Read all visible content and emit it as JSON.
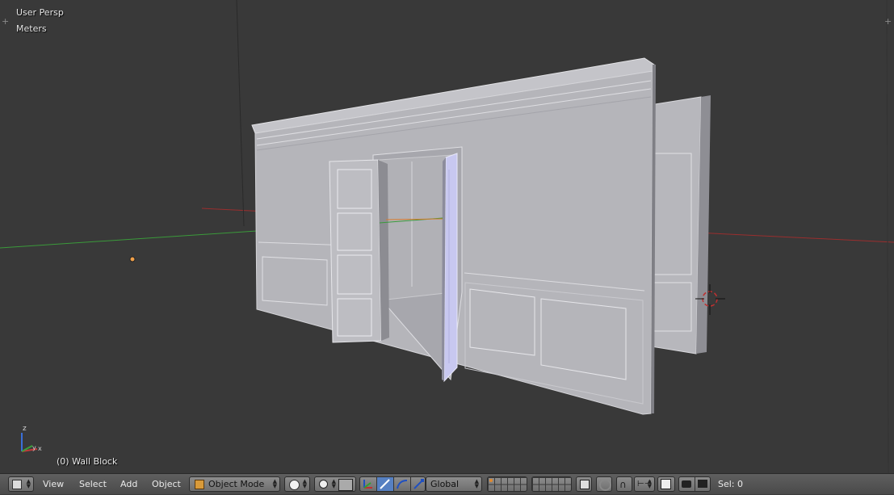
{
  "viewport": {
    "view_name": "User Persp",
    "units": "Meters",
    "active_object": "(0) Wall Block",
    "axis_z": "z",
    "axis_y": "y",
    "axis_x": "x"
  },
  "header": {
    "menu_view": "View",
    "menu_select": "Select",
    "menu_add": "Add",
    "menu_object": "Object",
    "mode": "Object Mode",
    "orientation": "Global",
    "selection_count": "Sel: 0"
  },
  "colors": {
    "viewport_bg": "#393939",
    "header_bg": "#555555",
    "wall": "#b5b5ba",
    "x_axis": "#b03030",
    "y_axis": "#2f8f2f",
    "active_button": "#5680c2"
  },
  "icons": [
    "editor-type-icon",
    "viewport-shading-icon",
    "pivot-icon",
    "manipulator-icon",
    "translate-icon",
    "rotate-icon",
    "scale-icon",
    "layers-icon",
    "lock-icon",
    "proportional-edit-icon",
    "snap-icon",
    "snap-element-icon",
    "snap-target-icon",
    "render-icon",
    "anim-render-icon",
    "cube-icon",
    "cursor-3d-icon",
    "origin-icon"
  ]
}
